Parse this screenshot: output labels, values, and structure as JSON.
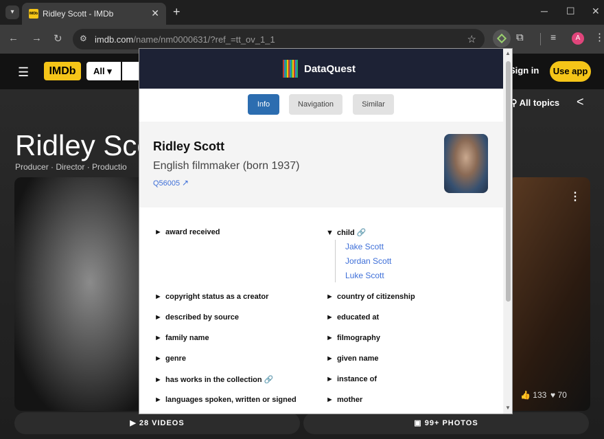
{
  "browser": {
    "tab_title": "Ridley Scott - IMDb",
    "tab_close": "✕",
    "new_tab": "+",
    "url_host": "imdb.com",
    "url_path": "/name/nm0000631/?ref_=tt_ov_1_1",
    "profile_initial": "A",
    "window": {
      "minimize": "─",
      "maximize": "☐",
      "close": "✕"
    }
  },
  "imdb": {
    "logo": "IMDb",
    "search_category": "All ▾",
    "sign_in": "Sign in",
    "use_app": "Use app",
    "all_topics": "All topics",
    "person_name": "Ridley Sco",
    "roles": "Producer · Director · Productio",
    "likes": "133",
    "reactions": "70",
    "videos_btn": "28 VIDEOS",
    "photos_btn": "99+ PHOTOS"
  },
  "dataquest": {
    "title": "DataQuest",
    "tabs": [
      {
        "label": "Info",
        "active": true
      },
      {
        "label": "Navigation",
        "active": false
      },
      {
        "label": "Similar",
        "active": false
      }
    ],
    "entity": {
      "name": "Ridley Scott",
      "description": "English filmmaker (born 1937)",
      "id": "Q56005"
    },
    "properties_left": [
      "award received",
      "copyright status as a creator",
      "described by source",
      "family name",
      "genre",
      "has works in the collection",
      "languages spoken, written or signed"
    ],
    "properties_right": [
      "child",
      "country of citizenship",
      "educated at",
      "filmography",
      "given name",
      "instance of",
      "mother"
    ],
    "children": [
      "Jake Scott",
      "Jordan Scott",
      "Luke Scott"
    ]
  },
  "colors": {
    "imdb_yellow": "#f5c518",
    "dataquest_header": "#1d2235",
    "active_tab": "#2c6db0",
    "link": "#3e6fd8"
  }
}
